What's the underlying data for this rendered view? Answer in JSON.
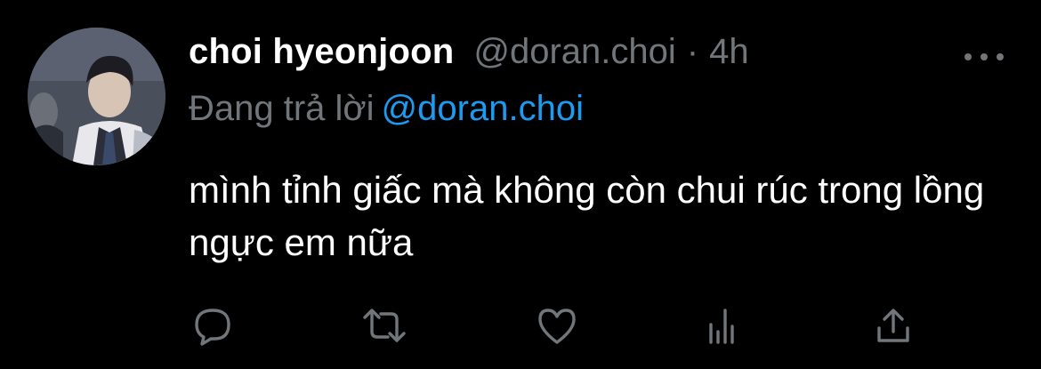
{
  "tweet": {
    "display_name": "choi hyeonjoon",
    "handle": "@doran.choi",
    "separator": "·",
    "time": "4h",
    "reply_prefix": "Đang trả lời",
    "reply_to": "@doran.choi",
    "text": "mình tỉnh giấc mà không còn chui rúc trong lồng ngực em nữa"
  },
  "actions": [
    {
      "icon": "reply-icon"
    },
    {
      "icon": "retweet-icon"
    },
    {
      "icon": "like-icon"
    },
    {
      "icon": "analytics-icon"
    },
    {
      "icon": "share-icon"
    }
  ],
  "colors": {
    "background": "#000000",
    "primary_text": "#ffffff",
    "secondary_text": "#71767b",
    "link": "#1d9bf0"
  }
}
